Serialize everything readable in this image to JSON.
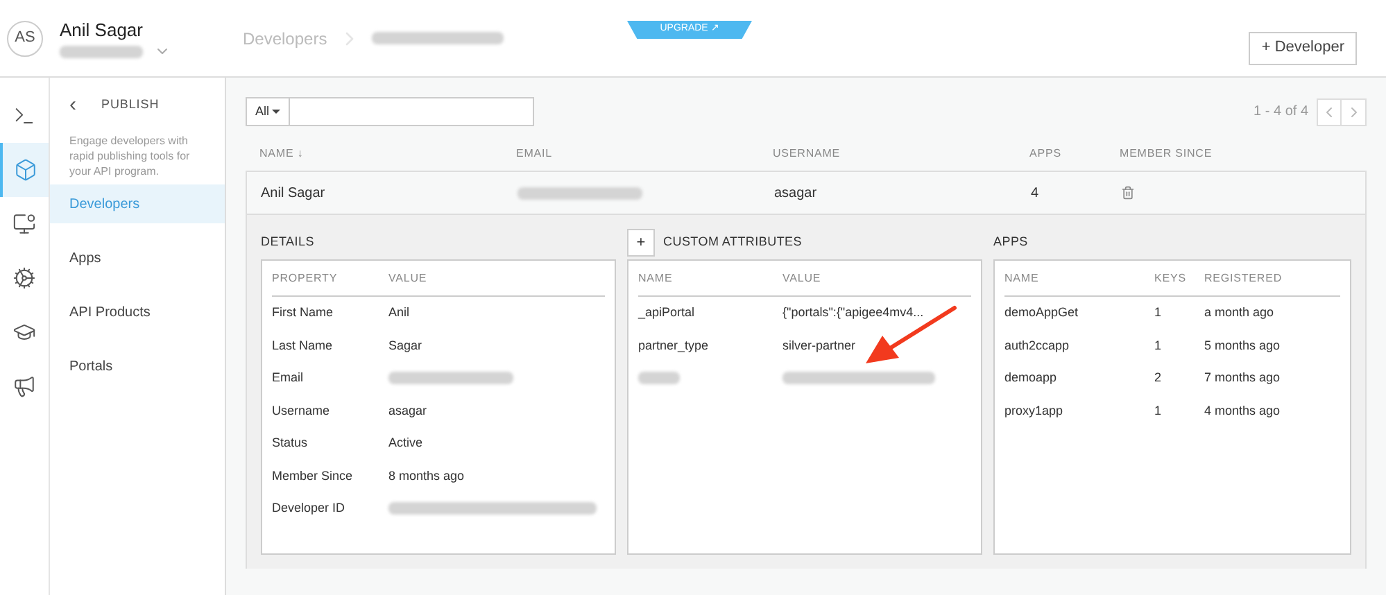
{
  "header": {
    "avatar": "AS",
    "user_name": "Anil Sagar",
    "breadcrumb": "Developers",
    "upgrade": "UPGRADE ↗",
    "add_button": "+ Developer"
  },
  "rail": [
    {
      "kind": "terminal",
      "selected": false
    },
    {
      "kind": "cube",
      "selected": true
    },
    {
      "kind": "monitor",
      "selected": false
    },
    {
      "kind": "gears",
      "selected": false
    },
    {
      "kind": "cap",
      "selected": false
    },
    {
      "kind": "megaphone",
      "selected": false
    }
  ],
  "nav": {
    "back": "‹",
    "title": "PUBLISH",
    "description": "Engage developers with rapid publishing tools for your API program.",
    "items": [
      {
        "label": "Developers",
        "selected": true
      },
      {
        "label": "Apps",
        "selected": false
      },
      {
        "label": "API Products",
        "selected": false
      },
      {
        "label": "Portals",
        "selected": false
      }
    ]
  },
  "toolbar": {
    "filter": "All",
    "pagination": "1 - 4 of 4"
  },
  "table": {
    "columns": [
      "NAME ↓",
      "EMAIL",
      "USERNAME",
      "APPS",
      "MEMBER SINCE"
    ],
    "row": {
      "name": "Anil Sagar",
      "username": "asagar",
      "apps": "4"
    }
  },
  "details": {
    "title": "DETAILS",
    "columns": [
      "PROPERTY",
      "VALUE"
    ],
    "rows": [
      {
        "property": "First Name",
        "value": "Anil"
      },
      {
        "property": "Last Name",
        "value": "Sagar"
      },
      {
        "property": "Email"
      },
      {
        "property": "Username",
        "value": "asagar"
      },
      {
        "property": "Status",
        "value": "Active"
      },
      {
        "property": "Member Since",
        "value": "8 months ago"
      },
      {
        "property": "Developer ID"
      }
    ]
  },
  "custom_attributes": {
    "add": "+",
    "title": "CUSTOM ATTRIBUTES",
    "columns": [
      "NAME",
      "VALUE"
    ],
    "rows": [
      {
        "name": "_apiPortal",
        "value": "{\"portals\":{\"apigee4mv4..."
      },
      {
        "name": "partner_type",
        "value": "silver-partner"
      },
      {}
    ]
  },
  "apps": {
    "title": "APPS",
    "columns": [
      "NAME",
      "KEYS",
      "REGISTERED"
    ],
    "rows": [
      {
        "name": "demoAppGet",
        "keys": "1",
        "registered": "a month ago"
      },
      {
        "name": "auth2ccapp",
        "keys": "1",
        "registered": "5 months ago"
      },
      {
        "name": "demoapp",
        "keys": "2",
        "registered": "7 months ago"
      },
      {
        "name": "proxy1app",
        "keys": "1",
        "registered": "4 months ago"
      }
    ]
  }
}
